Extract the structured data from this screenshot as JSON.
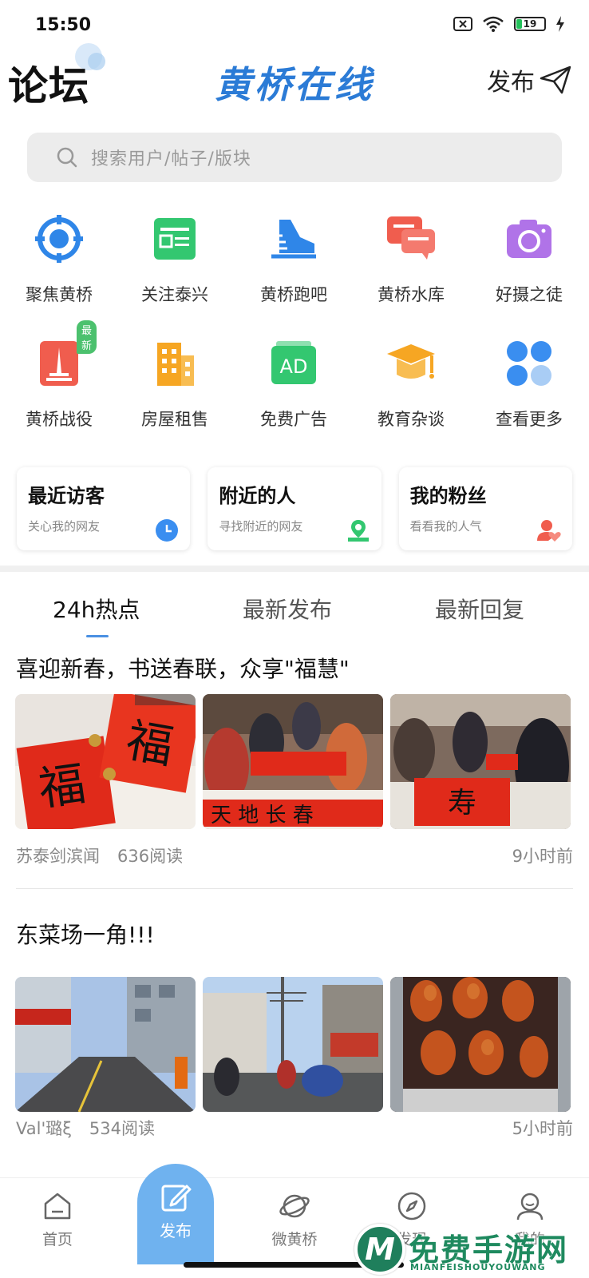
{
  "status_bar": {
    "time": "15:50",
    "battery": "19"
  },
  "header": {
    "title": "论坛",
    "logo_text": "黄桥在线",
    "publish_label": "发布"
  },
  "search": {
    "placeholder": "搜索用户/帖子/版块"
  },
  "grid": {
    "badge_new": "最新",
    "items": [
      {
        "label": "聚焦黄桥",
        "icon": "target-icon",
        "color": "#2f86e8"
      },
      {
        "label": "关注泰兴",
        "icon": "news-icon",
        "color": "#33c770"
      },
      {
        "label": "黄桥跑吧",
        "icon": "shoe-icon",
        "color": "#2f86e8"
      },
      {
        "label": "黄桥水库",
        "icon": "chat-icon",
        "color": "#f05d4e"
      },
      {
        "label": "好摄之徒",
        "icon": "camera-icon",
        "color": "#b073e8"
      },
      {
        "label": "黄桥战役",
        "icon": "monument-icon",
        "color": "#f05d4e"
      },
      {
        "label": "房屋租售",
        "icon": "building-icon",
        "color": "#f6a623"
      },
      {
        "label": "免费广告",
        "icon": "ad-icon",
        "color": "#33c770"
      },
      {
        "label": "教育杂谈",
        "icon": "graduation-cap-icon",
        "color": "#f6a623"
      },
      {
        "label": "查看更多",
        "icon": "more-grid-icon",
        "color": "#3a8ef0"
      }
    ]
  },
  "cards": [
    {
      "title": "最近访客",
      "subtitle": "关心我的网友",
      "icon": "clock-icon"
    },
    {
      "title": "附近的人",
      "subtitle": "寻找附近的网友",
      "icon": "location-icon"
    },
    {
      "title": "我的粉丝",
      "subtitle": "看看我的人气",
      "icon": "fans-icon"
    }
  ],
  "tabs": [
    {
      "label": "24h热点",
      "active": true
    },
    {
      "label": "最新发布",
      "active": false
    },
    {
      "label": "最新回复",
      "active": false
    }
  ],
  "posts": [
    {
      "title": "喜迎新春，书送春联，众享\"福慧\"",
      "author": "苏泰剑滨闻",
      "reads": "636阅读",
      "time": "9小时前"
    },
    {
      "title": "东菜场一角!!!",
      "author": "Val'璐ξ",
      "reads": "534阅读",
      "time": "5小时前"
    }
  ],
  "bottom_nav": {
    "home": "首页",
    "publish": "发布",
    "weihuangqiao": "微黄桥",
    "discover": "发现",
    "me": "我的"
  },
  "watermark": {
    "text": "免费手游网",
    "sub": "MIANFEISHOUYOUWANG",
    "logo_letter": "M"
  }
}
